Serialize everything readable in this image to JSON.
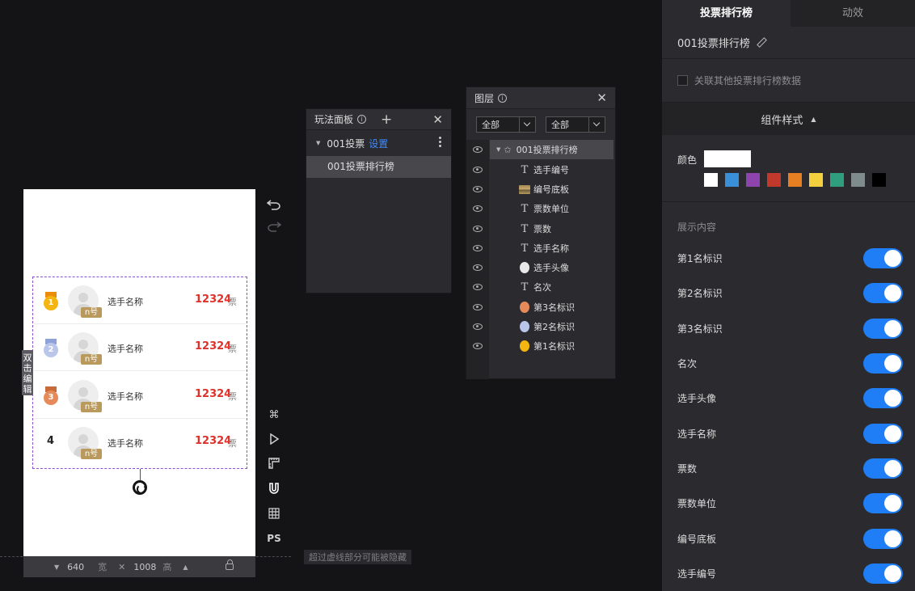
{
  "canvas": {
    "edit_tab": "双击编辑",
    "rows": [
      {
        "rank": "1",
        "medal_color": "#f5b511",
        "ribbon_color": "#e98d0b",
        "plate": "n号",
        "name": "选手名称",
        "votes": "12324",
        "unit": "票"
      },
      {
        "rank": "2",
        "medal_color": "#b9c6ea",
        "ribbon_color": "#8ea1d8",
        "plate": "n号",
        "name": "选手名称",
        "votes": "12324",
        "unit": "票"
      },
      {
        "rank": "3",
        "medal_color": "#e58a58",
        "ribbon_color": "#c96a3a",
        "plate": "n号",
        "name": "选手名称",
        "votes": "12324",
        "unit": "票"
      },
      {
        "rank": "4",
        "plate": "n号",
        "name": "选手名称",
        "votes": "12324",
        "unit": "票"
      }
    ],
    "size_bar": {
      "width": "640",
      "width_label": "宽",
      "height": "1008",
      "height_label": "高"
    },
    "guide_hint": "超过虚线部分可能被隐藏"
  },
  "toolbar": {
    "ps_label": "PS"
  },
  "play_panel": {
    "title": "玩法面板",
    "group_name": "001投票",
    "group_action": "设置",
    "item": "001投票排行榜"
  },
  "layers": {
    "title": "图层",
    "filter1": "全部",
    "filter2": "全部",
    "group": "001投票排行榜",
    "items": [
      {
        "label": "选手编号",
        "kind": "text"
      },
      {
        "label": "编号底板",
        "kind": "image"
      },
      {
        "label": "票数单位",
        "kind": "text"
      },
      {
        "label": "票数",
        "kind": "text"
      },
      {
        "label": "选手名称",
        "kind": "text"
      },
      {
        "label": "选手头像",
        "kind": "avatar"
      },
      {
        "label": "名次",
        "kind": "text"
      },
      {
        "label": "第3名标识",
        "kind": "medal",
        "color": "#e58a58"
      },
      {
        "label": "第2名标识",
        "kind": "medal",
        "color": "#b9c6ea"
      },
      {
        "label": "第1名标识",
        "kind": "medal",
        "color": "#f5b511"
      }
    ]
  },
  "right_panel": {
    "tabs": [
      "投票排行榜",
      "动效"
    ],
    "component_name": "001投票排行榜",
    "link_label": "关联其他投票排行榜数据",
    "style_section": "组件样式",
    "color_label": "颜色",
    "current_color": "#ffffff",
    "swatches": [
      "#ffffff",
      "#3a8fd9",
      "#8e44ad",
      "#c0392b",
      "#e67e22",
      "#f4d03f",
      "#2e9e7f",
      "#7f8c8d",
      "#000000"
    ],
    "show_title": "展示内容",
    "toggles": [
      "第1名标识",
      "第2名标识",
      "第3名标识",
      "名次",
      "选手头像",
      "选手名称",
      "票数",
      "票数单位",
      "编号底板",
      "选手编号"
    ]
  }
}
